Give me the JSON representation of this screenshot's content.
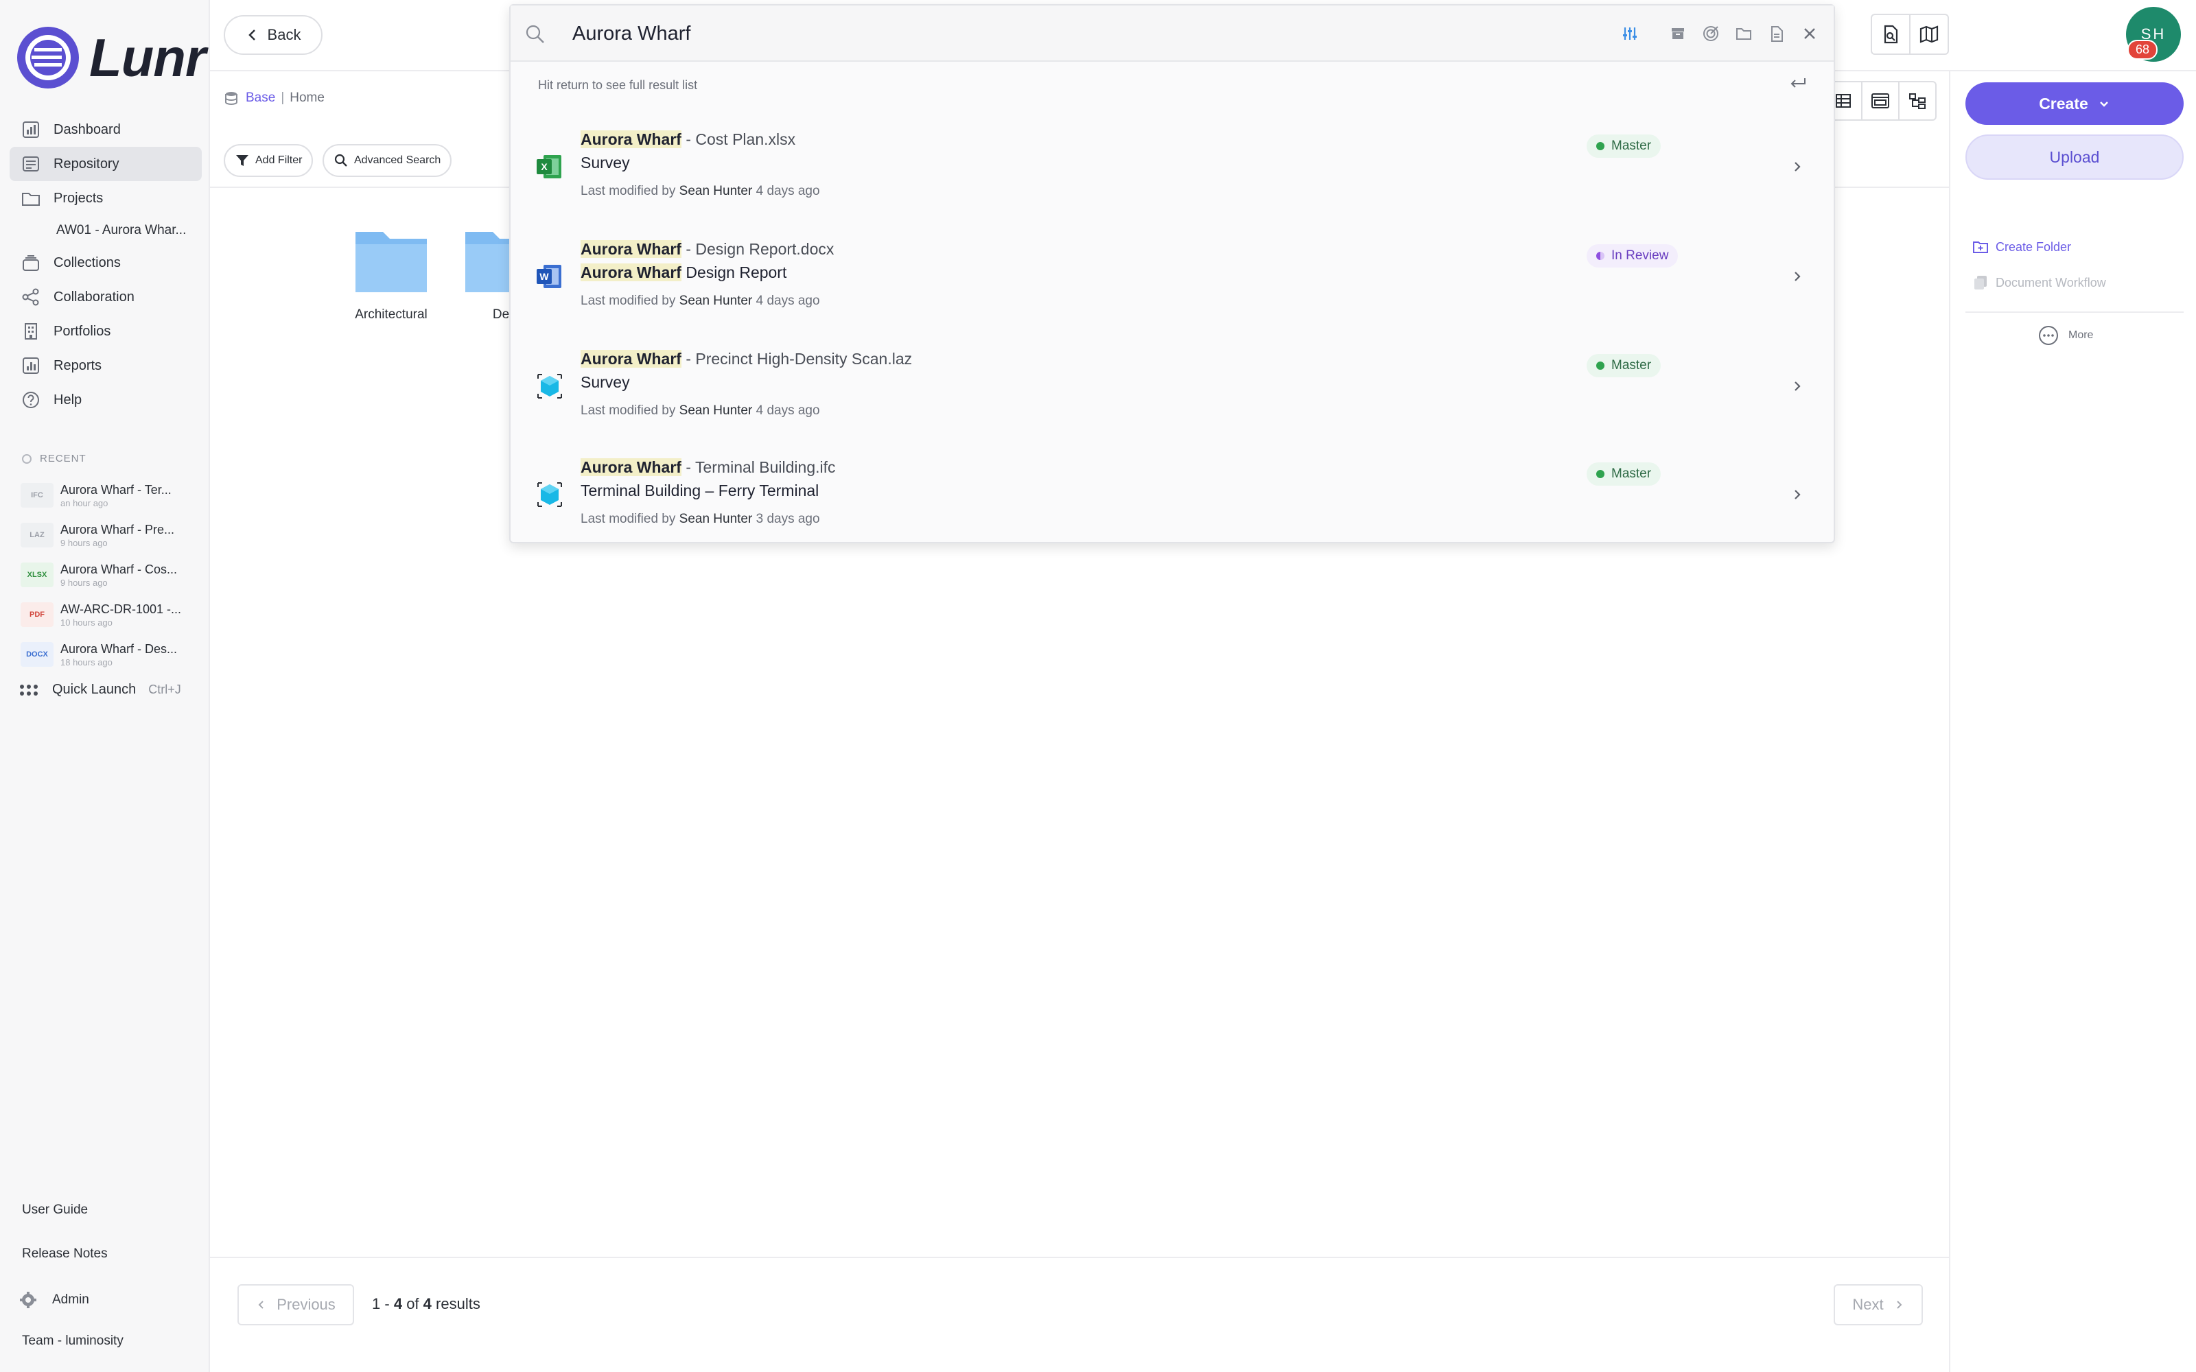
{
  "app": {
    "name": "Lunr"
  },
  "sidebar": {
    "nav": [
      {
        "label": "Dashboard",
        "icon": "dashboard-icon"
      },
      {
        "label": "Repository",
        "icon": "repository-icon",
        "active": true
      },
      {
        "label": "Projects",
        "icon": "folder-icon"
      },
      {
        "label": "AW01 - Aurora Whar...",
        "sub": true
      },
      {
        "label": "Collections",
        "icon": "collections-icon"
      },
      {
        "label": "Collaboration",
        "icon": "share-icon"
      },
      {
        "label": "Portfolios",
        "icon": "building-icon"
      },
      {
        "label": "Reports",
        "icon": "reports-icon"
      },
      {
        "label": "Help",
        "icon": "help-icon"
      }
    ],
    "recent_title": "RECENT",
    "recent": [
      {
        "type": "IFC",
        "name": "Aurora Wharf - Ter...",
        "time": "an hour ago",
        "color": "#9a9ea7",
        "bg": "#eef0f2"
      },
      {
        "type": "LAZ",
        "name": "Aurora Wharf - Pre...",
        "time": "9 hours ago",
        "color": "#9a9ea7",
        "bg": "#eef0f2"
      },
      {
        "type": "XLSX",
        "name": "Aurora Wharf - Cos...",
        "time": "9 hours ago",
        "color": "#2f8f3e",
        "bg": "#e8f5ea"
      },
      {
        "type": "PDF",
        "name": "AW-ARC-DR-1001 -...",
        "time": "10 hours ago",
        "color": "#d1453b",
        "bg": "#fbecea"
      },
      {
        "type": "DOCX",
        "name": "Aurora Wharf - Des...",
        "time": "18 hours ago",
        "color": "#3b6fd1",
        "bg": "#eaf0fb"
      }
    ],
    "quick_launch": {
      "label": "Quick Launch",
      "shortcut": "Ctrl+J"
    },
    "footer": {
      "user_guide": "User Guide",
      "release_notes": "Release Notes",
      "admin": "Admin",
      "team": "Team - luminosity"
    }
  },
  "topbar": {
    "back_label": "Back",
    "avatar_initials": "SH",
    "avatar_count": "68"
  },
  "breadcrumb": {
    "base": "Base",
    "sep": "|",
    "current": "Home"
  },
  "toolbar": {
    "add_filter": "Add Filter",
    "advanced_search": "Advanced Search"
  },
  "folders": [
    {
      "name": "Architectural"
    },
    {
      "name": "De"
    }
  ],
  "right_panel": {
    "create": "Create",
    "upload": "Upload",
    "create_folder": "Create Folder",
    "document_workflow": "Document Workflow",
    "more": "More"
  },
  "search": {
    "query": "Aurora Wharf",
    "hint": "Hit return to see full result list",
    "results": [
      {
        "hl": "Aurora Wharf",
        "rest": " - Cost Plan.xlsx",
        "line2_hl": "",
        "line2": "Survey",
        "modified_prefix": "Last modified by",
        "user": "Sean Hunter",
        "when": "4 days ago",
        "status": "Master",
        "status_kind": "master",
        "file": "xlsx"
      },
      {
        "hl": "Aurora Wharf",
        "rest": " - Design Report.docx",
        "line2_hl": "Aurora Wharf",
        "line2": " Design Report",
        "modified_prefix": "Last modified by",
        "user": "Sean Hunter",
        "when": "4 days ago",
        "status": "In Review",
        "status_kind": "review",
        "file": "docx"
      },
      {
        "hl": "Aurora Wharf",
        "rest": " - Precinct High-Density Scan.laz",
        "line2_hl": "",
        "line2": "Survey",
        "modified_prefix": "Last modified by",
        "user": "Sean Hunter",
        "when": "4 days ago",
        "status": "Master",
        "status_kind": "master",
        "file": "laz"
      },
      {
        "hl": "Aurora Wharf",
        "rest": " - Terminal Building.ifc",
        "line2_hl": "",
        "line2": "Terminal Building – Ferry Terminal",
        "modified_prefix": "Last modified by",
        "user": "Sean Hunter",
        "when": "3 days ago",
        "status": "Master",
        "status_kind": "master",
        "file": "ifc"
      }
    ]
  },
  "pagination": {
    "previous": "Previous",
    "next": "Next",
    "from": "1",
    "to": "4",
    "of_word": "of",
    "total": "4",
    "results_word": "results"
  },
  "colors": {
    "accent": "#6b5ce7",
    "master": "#2fa34f",
    "review": "#8e4fe0",
    "avatar": "#1e8a6b"
  }
}
